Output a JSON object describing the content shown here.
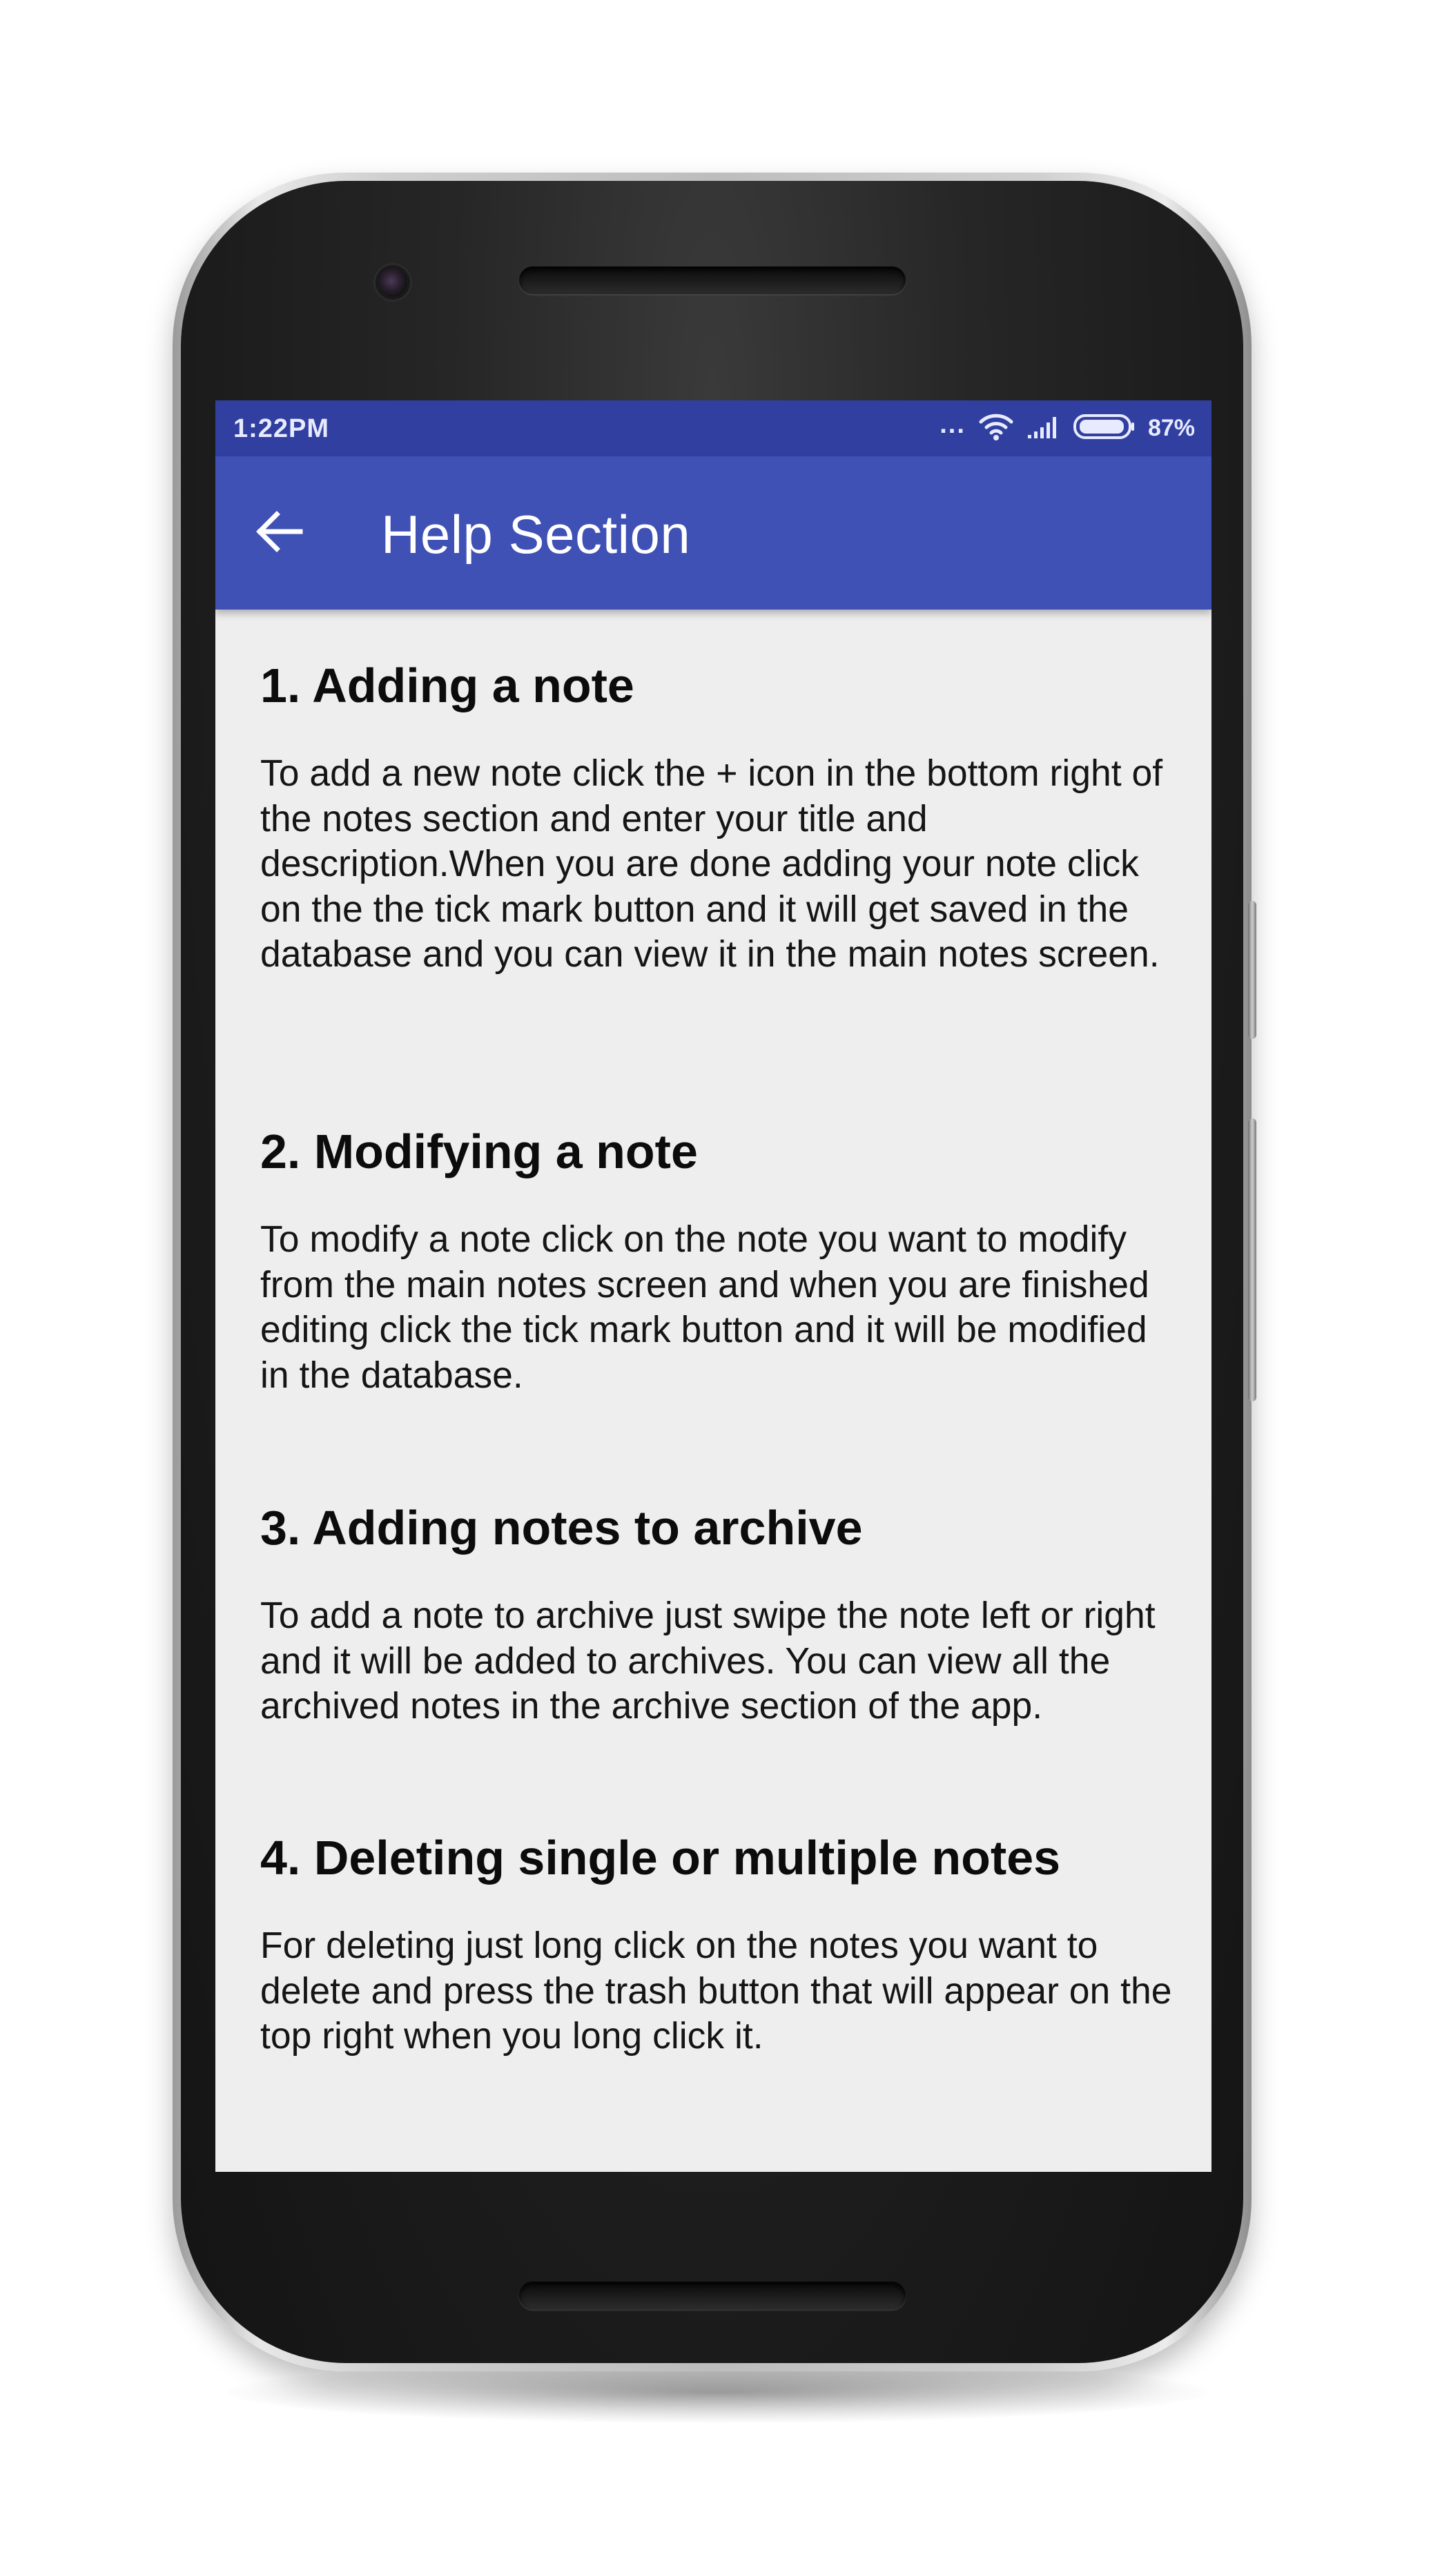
{
  "status_bar": {
    "time": "1:22PM",
    "dots": "...",
    "battery_percent": "87%",
    "icons": [
      "wifi-icon",
      "signal-icon",
      "battery-icon"
    ]
  },
  "app_bar": {
    "back_icon": "arrow-back-icon",
    "title": "Help Section"
  },
  "sections": [
    {
      "heading": "1. Adding a note",
      "body": "To add a new note click the + icon in the bottom right of the notes section and enter your title and description.When you are done adding your note click on the the tick mark button and it will get saved in the database and you can view it in the main notes screen."
    },
    {
      "heading": "2. Modifying a note",
      "body": "To modify a note click on the note you want to modify from the main notes screen and when you are finished editing click the tick mark button and it will be modified in the database."
    },
    {
      "heading": "3. Adding notes to archive",
      "body": "To add a note to archive just swipe the note left or right and it will be added to archives. You can view all the archived notes in the archive section of the app."
    },
    {
      "heading": "4. Deleting single or multiple notes",
      "body": "For deleting just long click on the notes you want to delete and press the trash button that will appear on the top right when you long click it."
    }
  ],
  "colors": {
    "status_bar": "#3140a0",
    "app_bar": "#3f51b5",
    "background": "#eeeeee"
  }
}
